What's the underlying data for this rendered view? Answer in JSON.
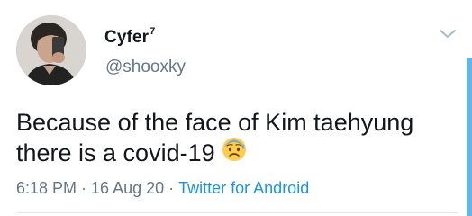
{
  "tweet": {
    "display_name": "Cyfer",
    "name_badge": "7",
    "handle": "@shooxky",
    "text_line_1": "Because of the face of Kim taehyung",
    "text_line_2": "there is a covid-19",
    "emoji_icon": "anxious-face-with-sweat-icon",
    "time": "6:18 PM",
    "separator_1": "·",
    "date": "16 Aug 20",
    "separator_2": "·",
    "source": "Twitter for Android"
  },
  "colors": {
    "primary_text": "#14171a",
    "secondary_text": "#657786",
    "link": "#1b95e0",
    "divider": "#e1e8ed",
    "scroll_accent": "#64b5e8"
  }
}
